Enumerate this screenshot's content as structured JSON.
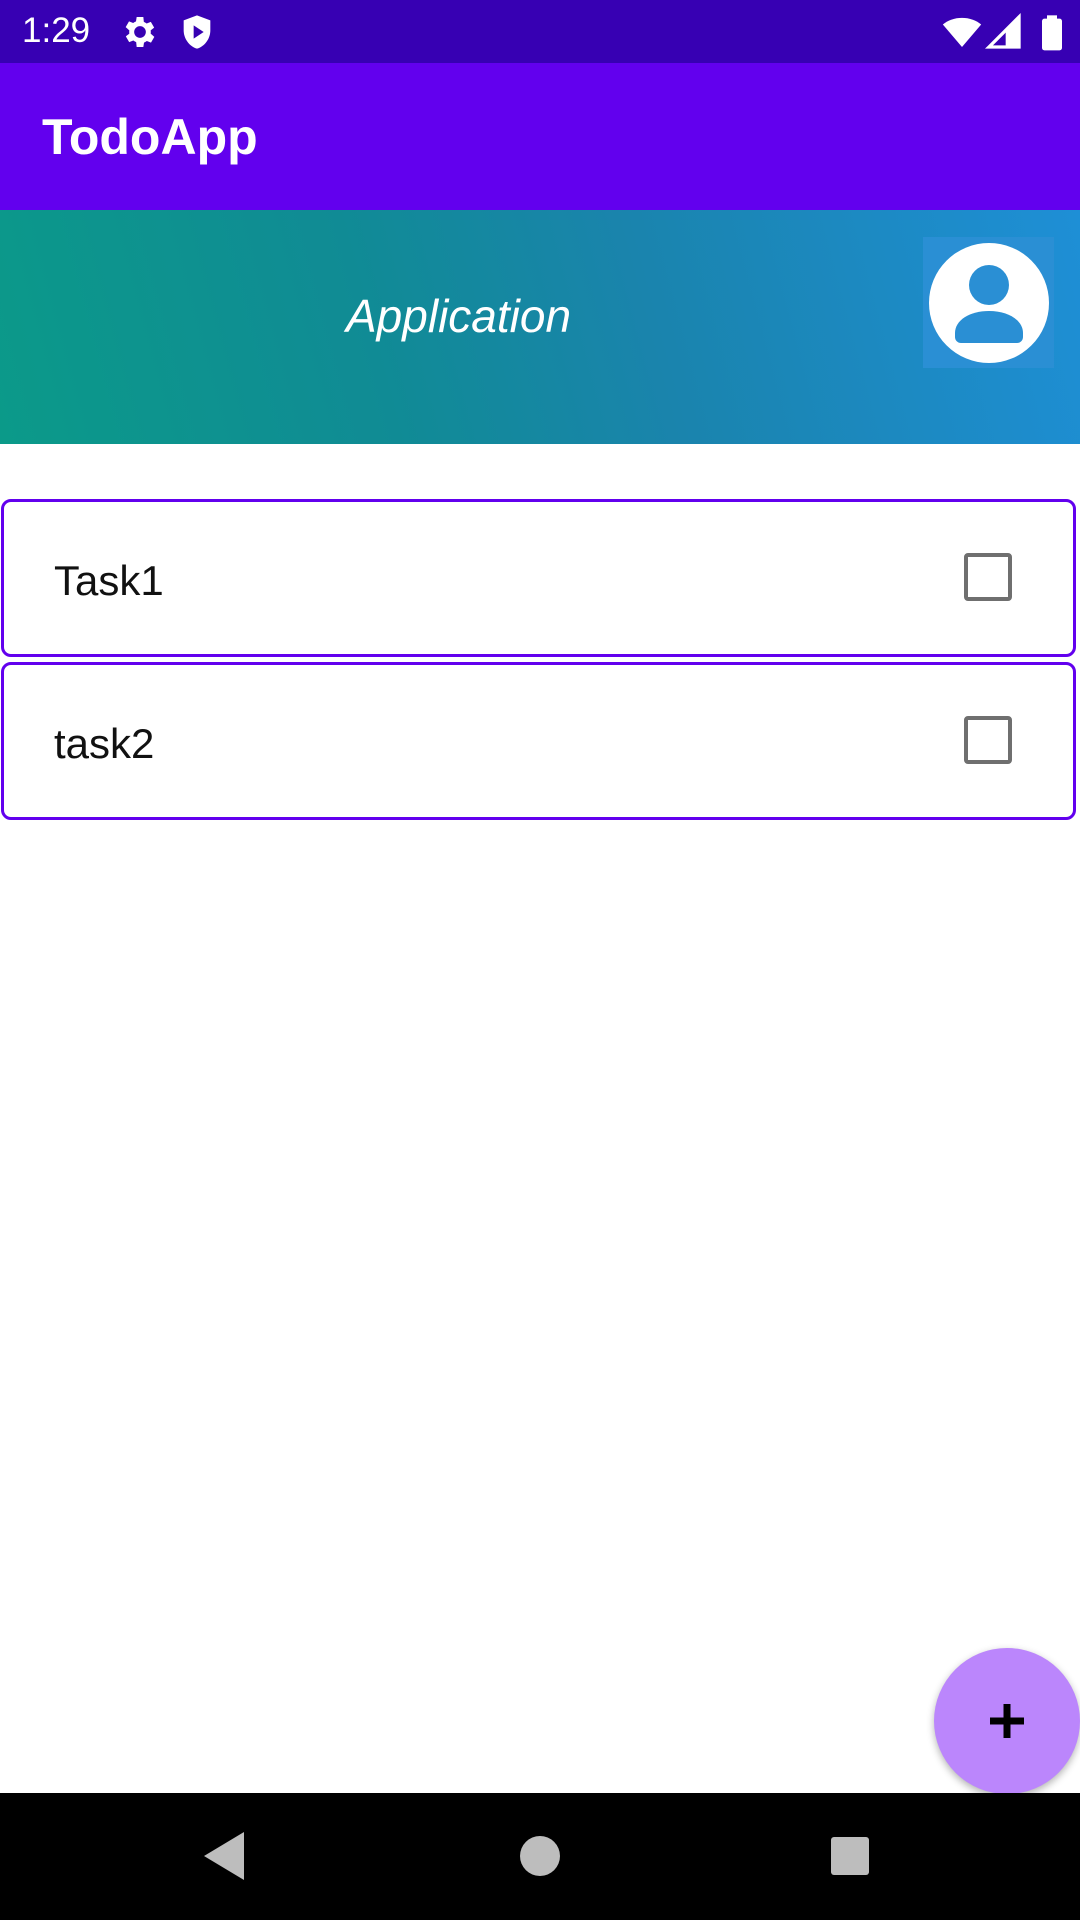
{
  "status_bar": {
    "time": "1:29",
    "icons": [
      "gear-icon",
      "shield-icon",
      "wifi-icon",
      "signal-icon",
      "battery-icon"
    ]
  },
  "app_bar": {
    "title": "TodoApp",
    "color": "#6200ee"
  },
  "header": {
    "label": "Application",
    "profile_icon": "account-circle-icon"
  },
  "tasks": [
    {
      "label": "Task1",
      "checked": false
    },
    {
      "label": "task2",
      "checked": false
    }
  ],
  "fab": {
    "icon": "plus-icon",
    "color": "#bb86fc"
  },
  "nav_bar": {
    "buttons": [
      "back-icon",
      "home-icon",
      "recents-icon"
    ]
  }
}
